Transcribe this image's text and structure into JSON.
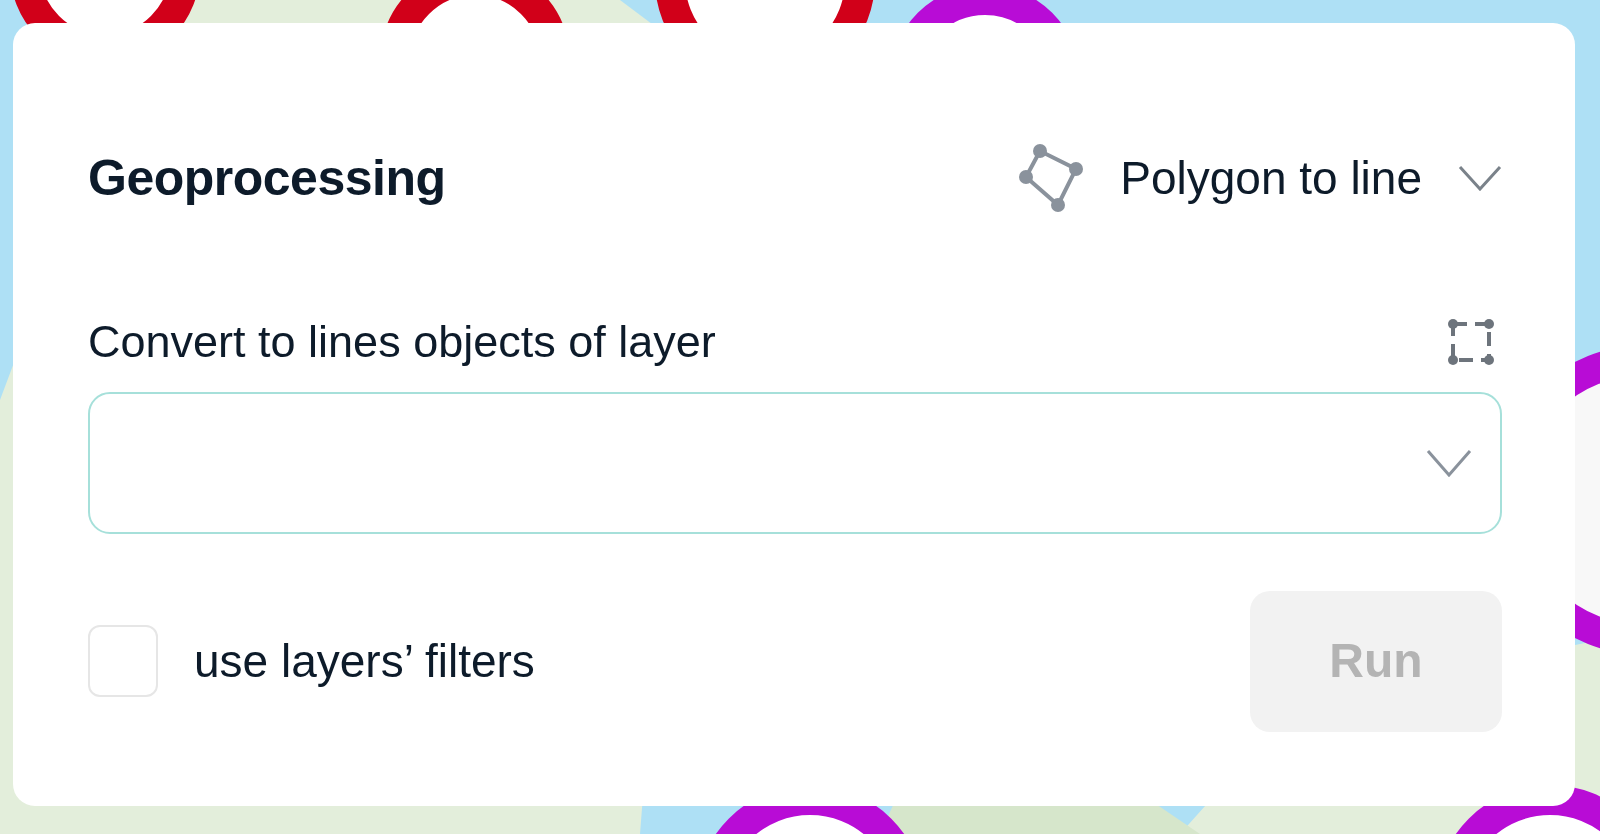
{
  "panel": {
    "title": "Geoprocessing",
    "operation": {
      "label": "Polygon to line"
    },
    "field_label": "Convert to lines objects of layer",
    "layer_select": {
      "expanded": false
    },
    "use_filters": {
      "label": "use layers’ filters",
      "checked": false
    },
    "run_button": {
      "label": "Run",
      "disabled": true
    }
  }
}
